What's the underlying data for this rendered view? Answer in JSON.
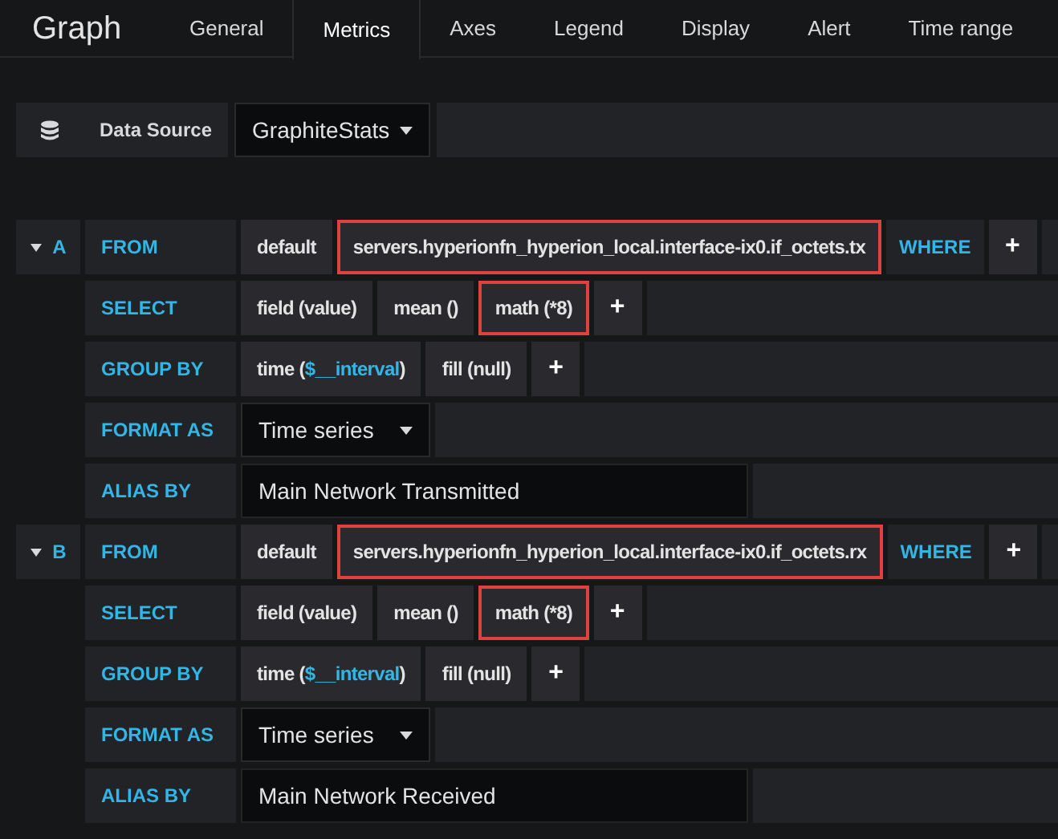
{
  "panel_title": "Graph",
  "tabs": [
    {
      "label": "General",
      "selected": false
    },
    {
      "label": "Metrics",
      "selected": true
    },
    {
      "label": "Axes",
      "selected": false
    },
    {
      "label": "Legend",
      "selected": false
    },
    {
      "label": "Display",
      "selected": false
    },
    {
      "label": "Alert",
      "selected": false
    },
    {
      "label": "Time range",
      "selected": false
    }
  ],
  "data_source": {
    "label": "Data Source",
    "value": "GraphiteStats"
  },
  "queries": [
    {
      "ref": "A",
      "expanded": true,
      "rows": [
        {
          "kind": "segments",
          "label": "FROM",
          "items": [
            {
              "kind": "segment",
              "parts": [
                {
                  "text": "default"
                }
              ],
              "highlighted": false
            },
            {
              "kind": "segment",
              "parts": [
                {
                  "text": "servers.hyperionfn_hyperion_local.interface-ix0.if_octets.tx"
                }
              ],
              "highlighted": true
            },
            {
              "kind": "keyword",
              "parts": [
                {
                  "text": "WHERE"
                }
              ]
            },
            {
              "kind": "add",
              "parts": [
                {
                  "text": "+"
                }
              ]
            }
          ]
        },
        {
          "kind": "segments",
          "label": "SELECT",
          "items": [
            {
              "kind": "segment",
              "parts": [
                {
                  "text": "field (value)"
                }
              ],
              "highlighted": false
            },
            {
              "kind": "segment",
              "parts": [
                {
                  "text": "mean ()"
                }
              ],
              "highlighted": false
            },
            {
              "kind": "segment",
              "parts": [
                {
                  "text": "math (*8)"
                }
              ],
              "highlighted": true
            },
            {
              "kind": "add",
              "parts": [
                {
                  "text": "+"
                }
              ]
            }
          ]
        },
        {
          "kind": "segments",
          "label": "GROUP BY",
          "items": [
            {
              "kind": "segment",
              "parts": [
                {
                  "text": "time ("
                },
                {
                  "text": "$__interval",
                  "variable": true
                },
                {
                  "text": ")"
                }
              ],
              "highlighted": false
            },
            {
              "kind": "segment",
              "parts": [
                {
                  "text": "fill (null)"
                }
              ],
              "highlighted": false
            },
            {
              "kind": "add",
              "parts": [
                {
                  "text": "+"
                }
              ]
            }
          ]
        },
        {
          "kind": "dropdown",
          "label": "FORMAT AS",
          "value": "Time series"
        },
        {
          "kind": "input",
          "label": "ALIAS BY",
          "value": "Main Network Transmitted"
        }
      ]
    },
    {
      "ref": "B",
      "expanded": true,
      "rows": [
        {
          "kind": "segments",
          "label": "FROM",
          "items": [
            {
              "kind": "segment",
              "parts": [
                {
                  "text": "default"
                }
              ],
              "highlighted": false
            },
            {
              "kind": "segment",
              "parts": [
                {
                  "text": "servers.hyperionfn_hyperion_local.interface-ix0.if_octets.rx"
                }
              ],
              "highlighted": true
            },
            {
              "kind": "keyword",
              "parts": [
                {
                  "text": "WHERE"
                }
              ]
            },
            {
              "kind": "add",
              "parts": [
                {
                  "text": "+"
                }
              ]
            }
          ]
        },
        {
          "kind": "segments",
          "label": "SELECT",
          "items": [
            {
              "kind": "segment",
              "parts": [
                {
                  "text": "field (value)"
                }
              ],
              "highlighted": false
            },
            {
              "kind": "segment",
              "parts": [
                {
                  "text": "mean ()"
                }
              ],
              "highlighted": false
            },
            {
              "kind": "segment",
              "parts": [
                {
                  "text": "math (*8)"
                }
              ],
              "highlighted": true
            },
            {
              "kind": "add",
              "parts": [
                {
                  "text": "+"
                }
              ]
            }
          ]
        },
        {
          "kind": "segments",
          "label": "GROUP BY",
          "items": [
            {
              "kind": "segment",
              "parts": [
                {
                  "text": "time ("
                },
                {
                  "text": "$__interval",
                  "variable": true
                },
                {
                  "text": ")"
                }
              ],
              "highlighted": false
            },
            {
              "kind": "segment",
              "parts": [
                {
                  "text": "fill (null)"
                }
              ],
              "highlighted": false
            },
            {
              "kind": "add",
              "parts": [
                {
                  "text": "+"
                }
              ]
            }
          ]
        },
        {
          "kind": "dropdown",
          "label": "FORMAT AS",
          "value": "Time series"
        },
        {
          "kind": "input",
          "label": "ALIAS BY",
          "value": "Main Network Received"
        }
      ]
    }
  ]
}
